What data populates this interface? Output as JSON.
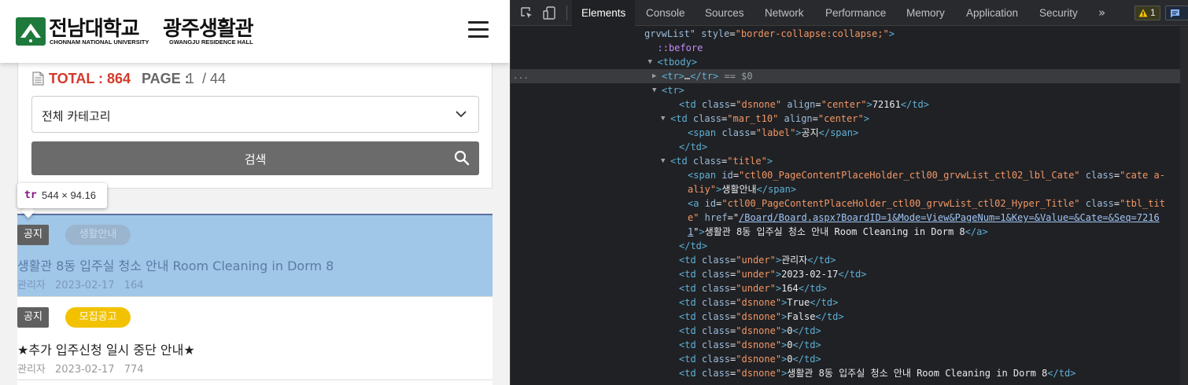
{
  "site": {
    "logo_kr_univ": "전남대학교",
    "logo_kr_hall": "광주생활관",
    "logo_en_univ": "CHONNAM NATIONAL UNIVERSITY",
    "logo_en_hall": "GWANGJU RESIDENCE HALL"
  },
  "board": {
    "total_label": "TOTAL : 864",
    "page_label": "PAGE :",
    "page_current": "1",
    "page_total": "/ 44",
    "category_value": "전체 카테고리",
    "search_button": "검색"
  },
  "tooltip": {
    "tag": "tr",
    "size": "544 × 94.16"
  },
  "posts": [
    {
      "notice": "공지",
      "category": "생활안내",
      "title": "생활관 8동 입주실 청소 안내 Room Cleaning in Dorm 8",
      "author": "관리자",
      "date": "2023-02-17",
      "views": "164"
    },
    {
      "notice": "공지",
      "category": "모집공고",
      "title": "★추가 입주신청 일시 중단 안내★",
      "author": "관리자",
      "date": "2023-02-17",
      "views": "774"
    }
  ],
  "devtools": {
    "tabs": [
      "Elements",
      "Console",
      "Sources",
      "Network",
      "Performance",
      "Memory",
      "Application",
      "Security"
    ],
    "more_tabs": "»",
    "warning_count": "1",
    "colors": {
      "background": "#202124",
      "tag": "#5db0d7",
      "attr_name": "#9bbbdc",
      "attr_value": "#f29766"
    },
    "selected_suffix": "== $0",
    "code_lines": [
      {
        "indent": 30,
        "parts": [
          [
            "an",
            "grvwList\""
          ],
          [
            "an",
            " style"
          ],
          [
            "tx",
            "="
          ],
          [
            "av",
            "\"border-collapse:collapse;\""
          ],
          [
            "t",
            ">"
          ]
        ]
      },
      {
        "indent": 33,
        "parts": [
          [
            "pe",
            "::before"
          ]
        ]
      },
      {
        "indent": 33,
        "arrow": "▼",
        "parts": [
          [
            "t",
            "<tbody>"
          ]
        ]
      },
      {
        "indent": 34,
        "arrow": "▶",
        "sel": true,
        "parts": [
          [
            "t",
            "<tr>"
          ],
          [
            "tx",
            "…"
          ],
          [
            "t",
            "</tr>"
          ],
          [
            "gray",
            " == $0"
          ]
        ]
      },
      {
        "indent": 34,
        "arrow": "▼",
        "parts": [
          [
            "t",
            "<tr>"
          ]
        ]
      },
      {
        "indent": 38,
        "parts": [
          [
            "t",
            "<td "
          ],
          [
            "an",
            "class"
          ],
          [
            "tx",
            "="
          ],
          [
            "av",
            "\"dsnone\""
          ],
          [
            "an",
            " align"
          ],
          [
            "tx",
            "="
          ],
          [
            "av",
            "\"center\""
          ],
          [
            "t",
            ">"
          ],
          [
            "tx",
            "72161"
          ],
          [
            "t",
            "</td>"
          ]
        ]
      },
      {
        "indent": 36,
        "arrow": "▼",
        "parts": [
          [
            "t",
            "<td "
          ],
          [
            "an",
            "class"
          ],
          [
            "tx",
            "="
          ],
          [
            "av",
            "\"mar_t10\""
          ],
          [
            "an",
            " align"
          ],
          [
            "tx",
            "="
          ],
          [
            "av",
            "\"center\""
          ],
          [
            "t",
            ">"
          ]
        ]
      },
      {
        "indent": 40,
        "parts": [
          [
            "t",
            "<span "
          ],
          [
            "an",
            "class"
          ],
          [
            "tx",
            "="
          ],
          [
            "av",
            "\"label\""
          ],
          [
            "t",
            ">"
          ],
          [
            "tx",
            "공지"
          ],
          [
            "t",
            "</span>"
          ]
        ]
      },
      {
        "indent": 38,
        "parts": [
          [
            "t",
            "</td>"
          ]
        ]
      },
      {
        "indent": 36,
        "arrow": "▼",
        "parts": [
          [
            "t",
            "<td "
          ],
          [
            "an",
            "class"
          ],
          [
            "tx",
            "="
          ],
          [
            "av",
            "\"title\""
          ],
          [
            "t",
            ">"
          ]
        ]
      },
      {
        "indent": 40,
        "parts": [
          [
            "t",
            "<span "
          ],
          [
            "an",
            "id"
          ],
          [
            "tx",
            "="
          ],
          [
            "av",
            "\"ctl00_PageContentPlaceHolder_ctl00_grvwList_ctl02_lbl_Cate\""
          ],
          [
            "an",
            " class"
          ],
          [
            "tx",
            "="
          ],
          [
            "av",
            "\"cate a-"
          ]
        ]
      },
      {
        "indent": 40,
        "parts": [
          [
            "av",
            "aliy\""
          ],
          [
            "t",
            ">"
          ],
          [
            "tx",
            "생활안내"
          ],
          [
            "t",
            "</span>"
          ]
        ]
      },
      {
        "indent": 40,
        "parts": [
          [
            "t",
            "<a "
          ],
          [
            "an",
            "id"
          ],
          [
            "tx",
            "="
          ],
          [
            "av",
            "\"ctl00_PageContentPlaceHolder_ctl00_grvwList_ctl02_Hyper_Title\""
          ],
          [
            "an",
            " class"
          ],
          [
            "tx",
            "="
          ],
          [
            "av",
            "\"tbl_tit"
          ]
        ]
      },
      {
        "indent": 40,
        "parts": [
          [
            "av",
            "e\""
          ],
          [
            "an",
            " href"
          ],
          [
            "tx",
            "="
          ],
          [
            "tx",
            "\""
          ],
          [
            "link",
            "/Board/Board.aspx?BoardID=1&Mode=View&PageNum=1&Key=&Value=&Cate=&Seq=7216"
          ]
        ]
      },
      {
        "indent": 40,
        "parts": [
          [
            "link",
            "1"
          ],
          [
            "tx",
            "\""
          ],
          [
            "t",
            ">"
          ],
          [
            "tx",
            "생활관 8동 입주실 청소 안내 Room Cleaning in Dorm 8"
          ],
          [
            "t",
            "</a>"
          ]
        ]
      },
      {
        "indent": 38,
        "parts": [
          [
            "t",
            "</td>"
          ]
        ]
      },
      {
        "indent": 38,
        "parts": [
          [
            "t",
            "<td "
          ],
          [
            "an",
            "class"
          ],
          [
            "tx",
            "="
          ],
          [
            "av",
            "\"under\""
          ],
          [
            "t",
            ">"
          ],
          [
            "tx",
            "관리자"
          ],
          [
            "t",
            "</td>"
          ]
        ]
      },
      {
        "indent": 38,
        "parts": [
          [
            "t",
            "<td "
          ],
          [
            "an",
            "class"
          ],
          [
            "tx",
            "="
          ],
          [
            "av",
            "\"under\""
          ],
          [
            "t",
            ">"
          ],
          [
            "tx",
            "2023-02-17"
          ],
          [
            "t",
            "</td>"
          ]
        ]
      },
      {
        "indent": 38,
        "parts": [
          [
            "t",
            "<td "
          ],
          [
            "an",
            "class"
          ],
          [
            "tx",
            "="
          ],
          [
            "av",
            "\"under\""
          ],
          [
            "t",
            ">"
          ],
          [
            "tx",
            "164"
          ],
          [
            "t",
            "</td>"
          ]
        ]
      },
      {
        "indent": 38,
        "parts": [
          [
            "t",
            "<td "
          ],
          [
            "an",
            "class"
          ],
          [
            "tx",
            "="
          ],
          [
            "av",
            "\"dsnone\""
          ],
          [
            "t",
            ">"
          ],
          [
            "tx",
            "True"
          ],
          [
            "t",
            "</td>"
          ]
        ]
      },
      {
        "indent": 38,
        "parts": [
          [
            "t",
            "<td "
          ],
          [
            "an",
            "class"
          ],
          [
            "tx",
            "="
          ],
          [
            "av",
            "\"dsnone\""
          ],
          [
            "t",
            ">"
          ],
          [
            "tx",
            "False"
          ],
          [
            "t",
            "</td>"
          ]
        ]
      },
      {
        "indent": 38,
        "parts": [
          [
            "t",
            "<td "
          ],
          [
            "an",
            "class"
          ],
          [
            "tx",
            "="
          ],
          [
            "av",
            "\"dsnone\""
          ],
          [
            "t",
            ">"
          ],
          [
            "tx",
            "0"
          ],
          [
            "t",
            "</td>"
          ]
        ]
      },
      {
        "indent": 38,
        "parts": [
          [
            "t",
            "<td "
          ],
          [
            "an",
            "class"
          ],
          [
            "tx",
            "="
          ],
          [
            "av",
            "\"dsnone\""
          ],
          [
            "t",
            ">"
          ],
          [
            "tx",
            "0"
          ],
          [
            "t",
            "</td>"
          ]
        ]
      },
      {
        "indent": 38,
        "parts": [
          [
            "t",
            "<td "
          ],
          [
            "an",
            "class"
          ],
          [
            "tx",
            "="
          ],
          [
            "av",
            "\"dsnone\""
          ],
          [
            "t",
            ">"
          ],
          [
            "tx",
            "0"
          ],
          [
            "t",
            "</td>"
          ]
        ]
      },
      {
        "indent": 38,
        "parts": [
          [
            "t",
            "<td "
          ],
          [
            "an",
            "class"
          ],
          [
            "tx",
            "="
          ],
          [
            "av",
            "\"dsnone\""
          ],
          [
            "t",
            ">"
          ],
          [
            "tx",
            "생활관 8동 입주실 청소 안내 Room Cleaning in Dorm 8"
          ],
          [
            "t",
            "</td>"
          ]
        ]
      }
    ]
  }
}
